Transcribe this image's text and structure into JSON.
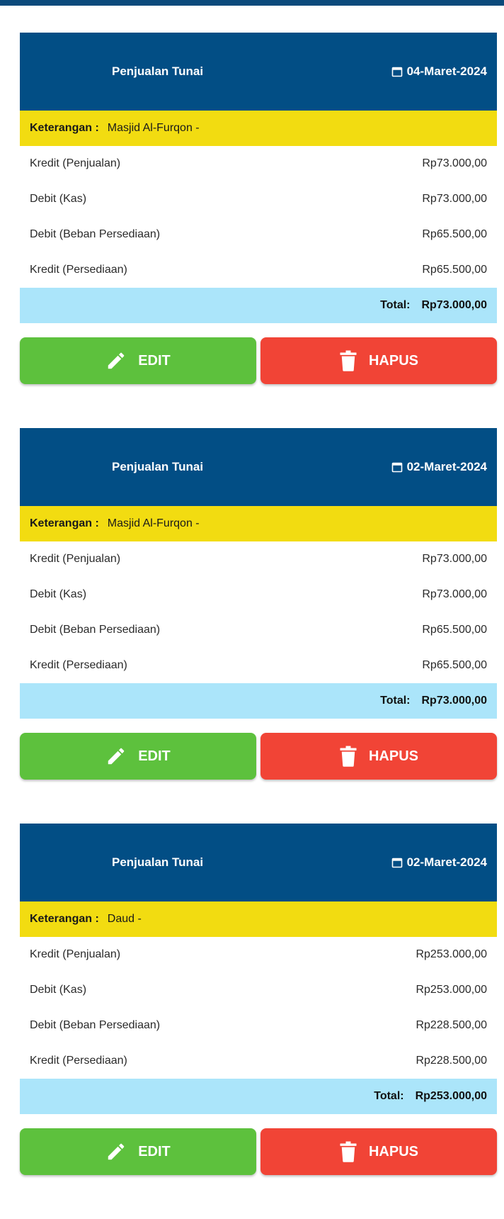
{
  "colors": {
    "header": "#024e85",
    "keterangan": "#f2dc11",
    "total": "#abe5fa",
    "edit": "#5dc13d",
    "hapus": "#f14436"
  },
  "icons": {
    "date": "calendar-icon",
    "edit": "pencil-icon",
    "hapus": "trash-icon"
  },
  "labels": {
    "keterangan": "Keterangan :",
    "total": "Total:",
    "edit": "EDIT",
    "hapus": "HAPUS"
  },
  "transactions": [
    {
      "title": "Penjualan Tunai",
      "date": "04-Maret-2024",
      "keterangan": "Masjid Al-Furqon -",
      "rows": [
        {
          "label": "Kredit (Penjualan)",
          "amount": "Rp73.000,00"
        },
        {
          "label": "Debit (Kas)",
          "amount": "Rp73.000,00"
        },
        {
          "label": "Debit (Beban Persediaan)",
          "amount": "Rp65.500,00"
        },
        {
          "label": "Kredit (Persediaan)",
          "amount": "Rp65.500,00"
        }
      ],
      "total": "Rp73.000,00"
    },
    {
      "title": "Penjualan Tunai",
      "date": "02-Maret-2024",
      "keterangan": "Masjid Al-Furqon -",
      "rows": [
        {
          "label": "Kredit (Penjualan)",
          "amount": "Rp73.000,00"
        },
        {
          "label": "Debit (Kas)",
          "amount": "Rp73.000,00"
        },
        {
          "label": "Debit (Beban Persediaan)",
          "amount": "Rp65.500,00"
        },
        {
          "label": "Kredit (Persediaan)",
          "amount": "Rp65.500,00"
        }
      ],
      "total": "Rp73.000,00"
    },
    {
      "title": "Penjualan Tunai",
      "date": "02-Maret-2024",
      "keterangan": "Daud -",
      "rows": [
        {
          "label": "Kredit (Penjualan)",
          "amount": "Rp253.000,00"
        },
        {
          "label": "Debit (Kas)",
          "amount": "Rp253.000,00"
        },
        {
          "label": "Debit (Beban Persediaan)",
          "amount": "Rp228.500,00"
        },
        {
          "label": "Kredit (Persediaan)",
          "amount": "Rp228.500,00"
        }
      ],
      "total": "Rp253.000,00"
    }
  ]
}
